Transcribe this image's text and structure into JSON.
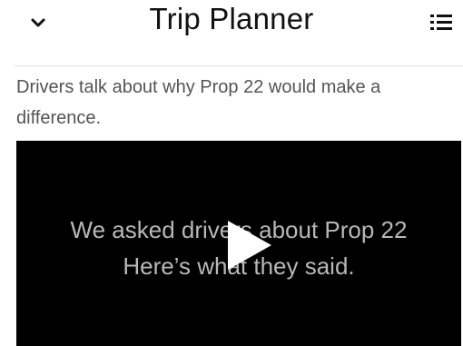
{
  "header": {
    "title": "Trip Planner",
    "collapse_icon": "chevron-down-icon",
    "menu_icon": "list-menu-icon"
  },
  "content": {
    "caption": "Drivers talk about why Prop 22 would make a difference."
  },
  "video": {
    "line1": "We asked drivers about Prop 22",
    "line2": "Here’s what they said.",
    "play_icon": "play-icon",
    "background": "#000000"
  }
}
